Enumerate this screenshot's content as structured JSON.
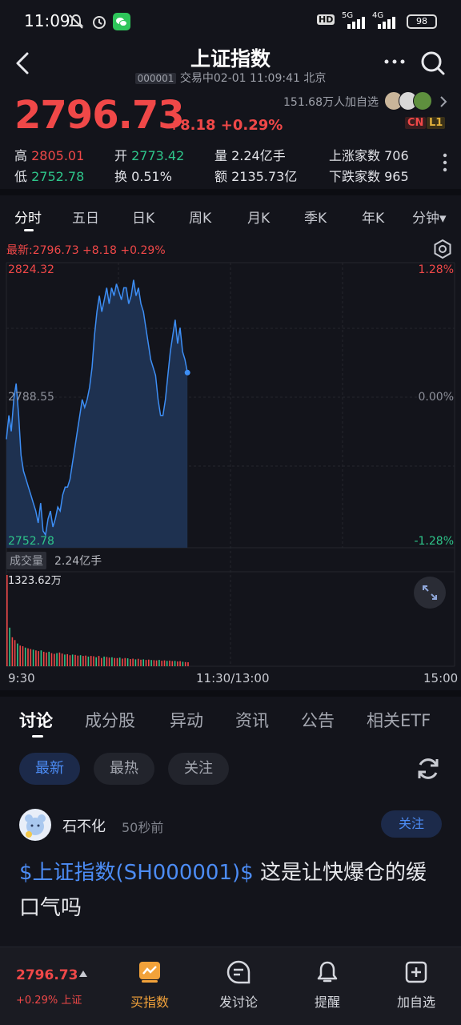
{
  "status_bar": {
    "time": "11:09",
    "battery": "98",
    "network_5g": "5G",
    "network_4g": "4G",
    "hd": "HD"
  },
  "header": {
    "title": "上证指数",
    "code": "000001",
    "subtitle": "交易中02-01 11:09:41 北京"
  },
  "quote": {
    "price": "2796.73",
    "change": "+8.18 +0.29%",
    "followers": "151.68万人加自选",
    "tag_cn": "CN",
    "tag_l1": "L1"
  },
  "stats": {
    "high_label": "高",
    "high": "2805.01",
    "open_label": "开",
    "open": "2773.42",
    "volume": "量 2.24亿手",
    "advancers": "上涨家数 706",
    "low_label": "低",
    "low": "2752.78",
    "turnover": "换 0.51%",
    "amount": "额 2135.73亿",
    "decliners": "下跌家数 965"
  },
  "period_tabs": [
    "分时",
    "五日",
    "日K",
    "周K",
    "月K",
    "季K",
    "年K",
    "分钟▾"
  ],
  "chart": {
    "info_line": "最新:2796.73  +8.18  +0.29%",
    "y_top": "2824.32",
    "y_mid": "2788.55",
    "y_bottom": "2752.78",
    "pct_top": "1.28%",
    "pct_mid": "0.00%",
    "pct_bottom": "-1.28%",
    "volume_badge": "成交量",
    "volume_total": "2.24亿手",
    "volume_max": "1323.62万",
    "time_start": "9:30",
    "time_mid": "11:30/13:00",
    "time_end": "15:00"
  },
  "content_tabs": [
    "讨论",
    "成分股",
    "异动",
    "资讯",
    "公告",
    "相关ETF"
  ],
  "filter_chips": [
    "最新",
    "最热",
    "关注"
  ],
  "post": {
    "author": "石不化",
    "time": "50秒前",
    "follow_label": "关注",
    "link_text": "$上证指数(SH000001)$",
    "body_text": " 这是让快爆仓的缓口气吗"
  },
  "bottom_nav": {
    "price": "2796.73",
    "change": "+0.29% 上证",
    "items": [
      "买指数",
      "发讨论",
      "提醒",
      "加自选"
    ]
  },
  "colors": {
    "up": "#f04848",
    "down": "#2ec58a",
    "accent": "#4c8cf5",
    "line": "#3d8ef5",
    "background": "#13141b"
  },
  "chart_data": {
    "type": "area",
    "price_series": [
      2780,
      2786,
      2782,
      2790,
      2794,
      2786,
      2776,
      2772,
      2770,
      2768,
      2766,
      2764,
      2762,
      2759,
      2764,
      2757,
      2756,
      2760,
      2762,
      2758,
      2760,
      2763,
      2762,
      2766,
      2768,
      2768,
      2770,
      2774,
      2778,
      2782,
      2786,
      2790,
      2788,
      2790,
      2793,
      2798,
      2806,
      2812,
      2816,
      2812,
      2815,
      2818,
      2814,
      2818,
      2816,
      2819,
      2817,
      2815,
      2818,
      2818,
      2814,
      2816,
      2820,
      2816,
      2818,
      2814,
      2812,
      2808,
      2804,
      2800,
      2798,
      2796,
      2790,
      2786,
      2786,
      2790,
      2796,
      2802,
      2806,
      2810,
      2804,
      2808,
      2802,
      2800,
      2796.73
    ],
    "volume_series": [
      1323.62,
      560,
      420,
      380,
      330,
      300,
      290,
      270,
      260,
      250,
      240,
      230,
      220,
      230,
      210,
      200,
      210,
      190,
      180,
      190,
      200,
      185,
      170,
      175,
      160,
      170,
      165,
      155,
      160,
      150,
      155,
      140,
      150,
      145,
      130,
      150,
      120,
      140,
      135,
      125,
      130,
      120,
      118,
      125,
      110,
      120,
      115,
      105,
      110,
      100,
      108,
      95,
      100,
      92,
      96,
      90,
      88,
      85,
      92,
      80,
      86,
      78,
      82,
      75,
      78,
      70,
      74,
      65,
      60,
      58
    ],
    "y_range": [
      2752.78,
      2824.32
    ],
    "pct_range": [
      -1.28,
      1.28
    ],
    "prev_close": 2788.55,
    "x_labels": [
      "9:30",
      "11:30/13:00",
      "15:00"
    ]
  }
}
